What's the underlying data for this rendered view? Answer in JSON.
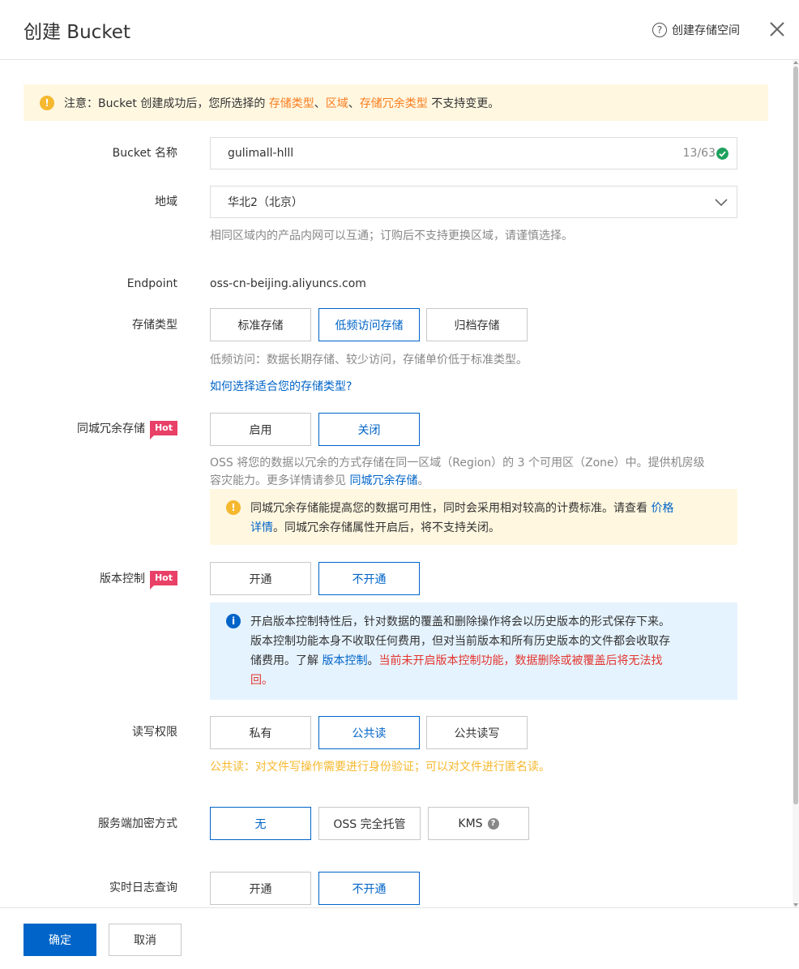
{
  "header": {
    "title": "创建 Bucket",
    "help_icon": "question-circle-icon",
    "help_label": "创建存储空间",
    "close_icon": "close-icon"
  },
  "notice": {
    "prefix": "注意：Bucket 创建成功后，您所选择的 ",
    "h1": "存储类型",
    "sep1": "、",
    "h2": "区域",
    "sep2": "、",
    "h3": "存储冗余类型",
    "suffix": " 不支持变更。"
  },
  "fields": {
    "bucket_name": {
      "label": "Bucket 名称",
      "value": "gulimall-hlll",
      "counter": "13/63"
    },
    "region": {
      "label": "地域",
      "value": "华北2（北京）",
      "hint": "相同区域内的产品内网可以互通；订购后不支持更换区域，请谨慎选择。"
    },
    "endpoint": {
      "label": "Endpoint",
      "value": "oss-cn-beijing.aliyuncs.com"
    },
    "storage_class": {
      "label": "存储类型",
      "options": [
        "标准存储",
        "低频访问存储",
        "归档存储"
      ],
      "selected": "低频访问存储",
      "hint": "低频访问：数据长期存储、较少访问，存储单价低于标准类型。",
      "link": "如何选择适合您的存储类型?"
    },
    "zrs": {
      "label": "同城冗余存储",
      "badge": "Hot",
      "options": [
        "启用",
        "关闭"
      ],
      "selected": "关闭",
      "hint_line1": "OSS 将您的数据以冗余的方式存储在同一区域（Region）的 3 个可用区（Zone）中。提供机房级",
      "hint_line2_prefix": "容灾能力。更多详情请参见 ",
      "hint_link": "同城冗余存储",
      "hint_line2_suffix": "。",
      "alert_text": "同城冗余存储能提高您的数据可用性，同时会采用相对较高的计费标准。请查看 ",
      "alert_link_1": "价格",
      "alert_link_2": "详情",
      "alert_text_2": "。同城冗余存储属性开启后，将不支持关闭。"
    },
    "versioning": {
      "label": "版本控制",
      "badge": "Hot",
      "options": [
        "开通",
        "不开通"
      ],
      "selected": "不开通",
      "alert_line1": "开启版本控制特性后，针对数据的覆盖和删除操作将会以历史版本的形式保存下来。",
      "alert_line2": "版本控制功能本身不收取任何费用，但对当前版本和所有历史版本的文件都会收取存",
      "alert_line3_prefix": "储费用。了解 ",
      "alert_link": "版本控制",
      "alert_line3_mid": "。",
      "alert_red_1": "当前未开启版本控制功能，数据删除或被覆盖后将无法找",
      "alert_red_2": "回。"
    },
    "acl": {
      "label": "读写权限",
      "options": [
        "私有",
        "公共读",
        "公共读写"
      ],
      "selected": "公共读",
      "warning": "公共读：对文件写操作需要进行身份验证；可以对文件进行匿名读。"
    },
    "encryption": {
      "label": "服务端加密方式",
      "options": [
        "无",
        "OSS 完全托管",
        "KMS"
      ],
      "selected": "无"
    },
    "realtime_log": {
      "label": "实时日志查询",
      "options": [
        "开通",
        "不开通"
      ],
      "selected": "不开通"
    }
  },
  "footer": {
    "confirm": "确定",
    "cancel": "取消"
  },
  "colors": {
    "accent": "#0064c8",
    "warning": "#f5b82e",
    "hot": "#e84067",
    "danger": "#e3352f",
    "success": "#1fa15d"
  }
}
